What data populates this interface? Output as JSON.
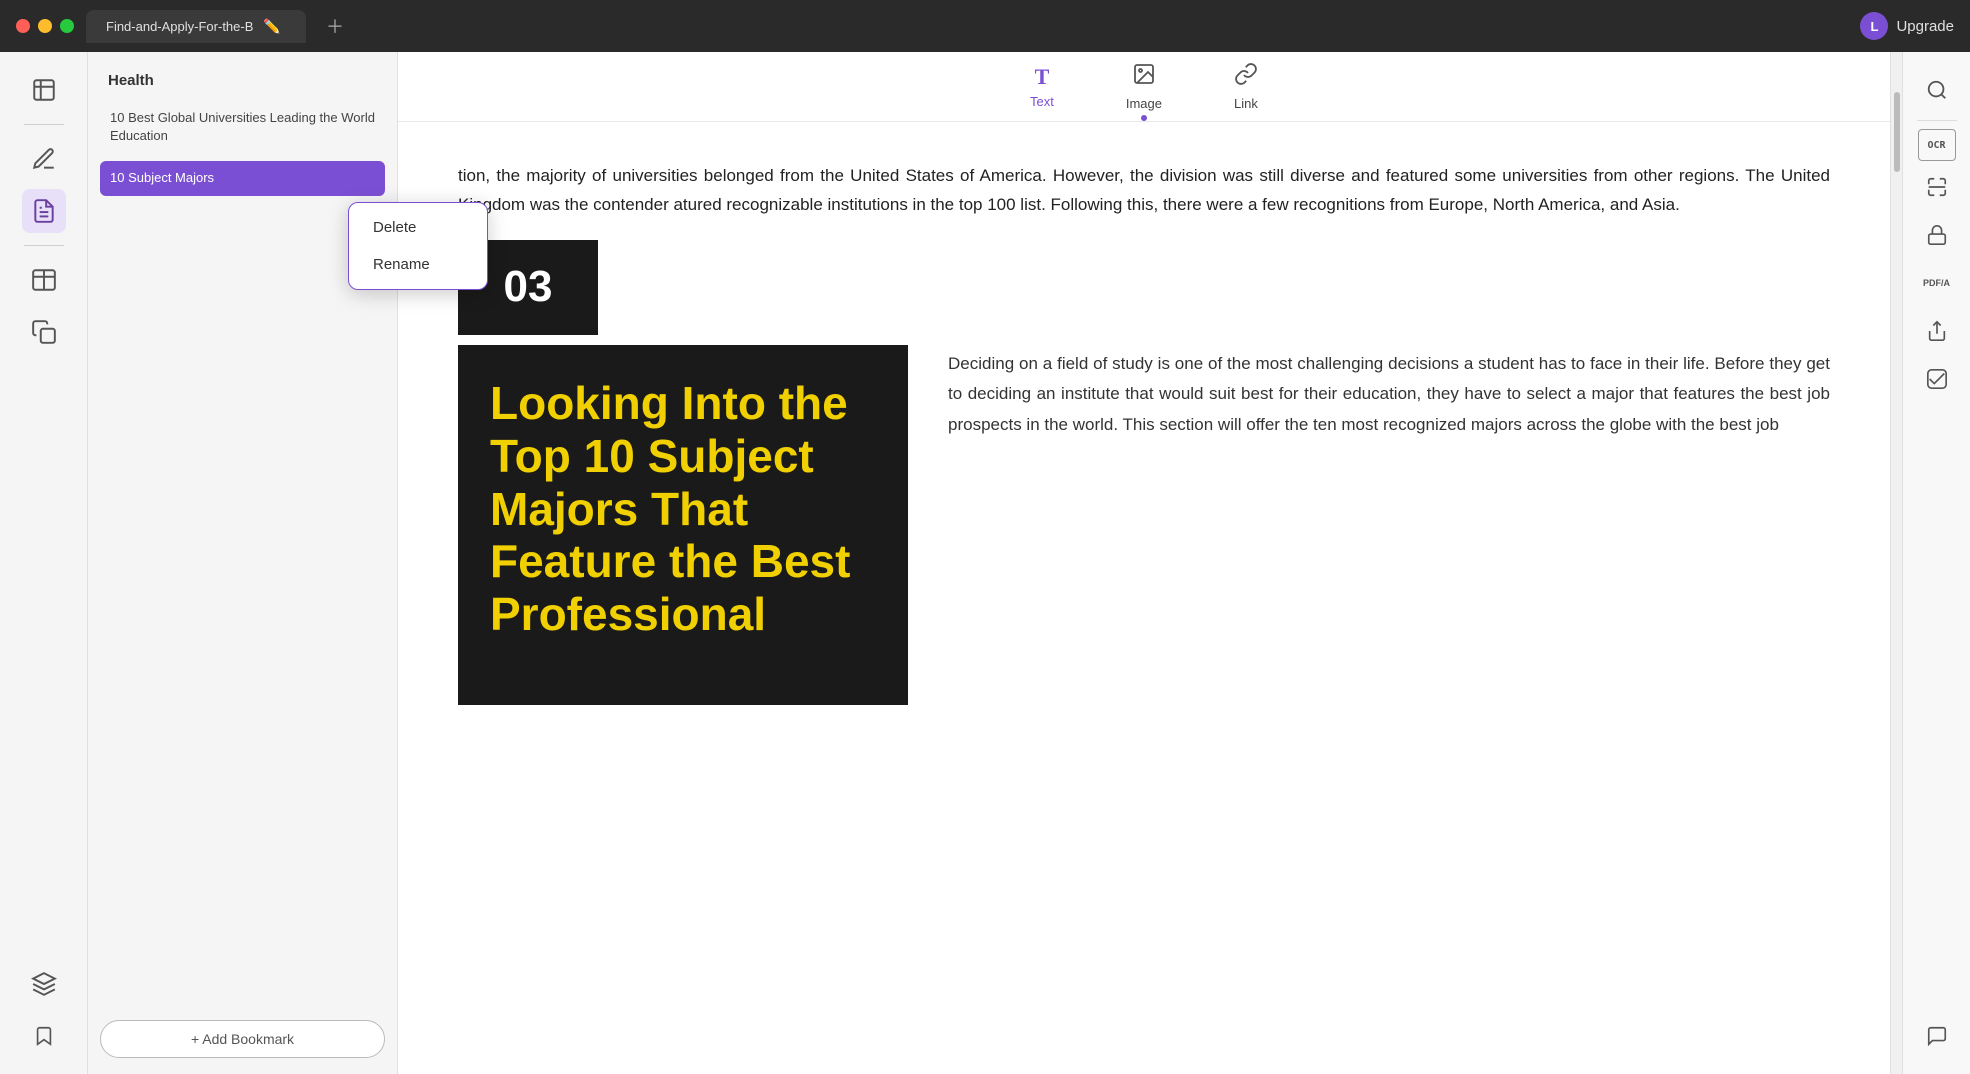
{
  "titlebar": {
    "tab_title": "Find-and-Apply-For-the-B",
    "upgrade_label": "Upgrade",
    "avatar_initial": "L"
  },
  "sidebar": {
    "icons": [
      {
        "name": "bookmarks-icon",
        "symbol": "📄",
        "active": false
      },
      {
        "name": "annotate-icon",
        "symbol": "✏️",
        "active": false
      },
      {
        "name": "notes-icon",
        "symbol": "📋",
        "active": true
      },
      {
        "name": "pages-icon",
        "symbol": "🗂️",
        "active": false
      },
      {
        "name": "copy-icon",
        "symbol": "📑",
        "active": false
      }
    ],
    "bottom_icons": [
      {
        "name": "layers-icon",
        "symbol": "◈"
      },
      {
        "name": "bookmark-icon",
        "symbol": "🔖"
      }
    ]
  },
  "panel": {
    "category": "Health",
    "items": [
      {
        "label": "10 Best Global Universities Leading the World Education",
        "active": false
      },
      {
        "label": "10 Subject Majors",
        "active": true
      }
    ],
    "add_bookmark_label": "+ Add Bookmark"
  },
  "context_menu": {
    "items": [
      {
        "label": "Delete"
      },
      {
        "label": "Rename"
      }
    ]
  },
  "toolbar": {
    "buttons": [
      {
        "label": "Text",
        "icon": "T",
        "active": true
      },
      {
        "label": "Image",
        "icon": "🖼",
        "active": false
      },
      {
        "label": "Link",
        "icon": "🔗",
        "active": false
      }
    ]
  },
  "document": {
    "paragraph1": "tion, the majority of universities belonged from the United States of America. However, the division was still diverse and featured some universities from other regions. The United Kingdom was the contender atured recognizable institutions in the top 100 list. Following this, there were a few recognitions from Europe, North America, and Asia.",
    "section_number": "03",
    "section_image_text": "Looking Into the Top 10 Subject Majors That Feature the Best Professional",
    "section_desc": "Deciding on a field of study is one of the most challenging decisions a student has to face in their life. Before they get to deciding an institute that would suit best for their education, they have to select a major that features the best job prospects in the world. This section will offer the ten most recognized majors across the globe with the best job"
  },
  "right_sidebar": {
    "icons": [
      {
        "name": "search-icon",
        "symbol": "🔍"
      },
      {
        "name": "ocr-icon",
        "label": "OCR"
      },
      {
        "name": "scan-icon",
        "symbol": "⬛"
      },
      {
        "name": "secure-icon",
        "symbol": "🔒"
      },
      {
        "name": "pdfa-icon",
        "label": "PDF/A"
      },
      {
        "name": "share-icon",
        "symbol": "⬆"
      },
      {
        "name": "check-icon",
        "symbol": "✔"
      },
      {
        "name": "chat-icon",
        "symbol": "💬"
      }
    ]
  }
}
